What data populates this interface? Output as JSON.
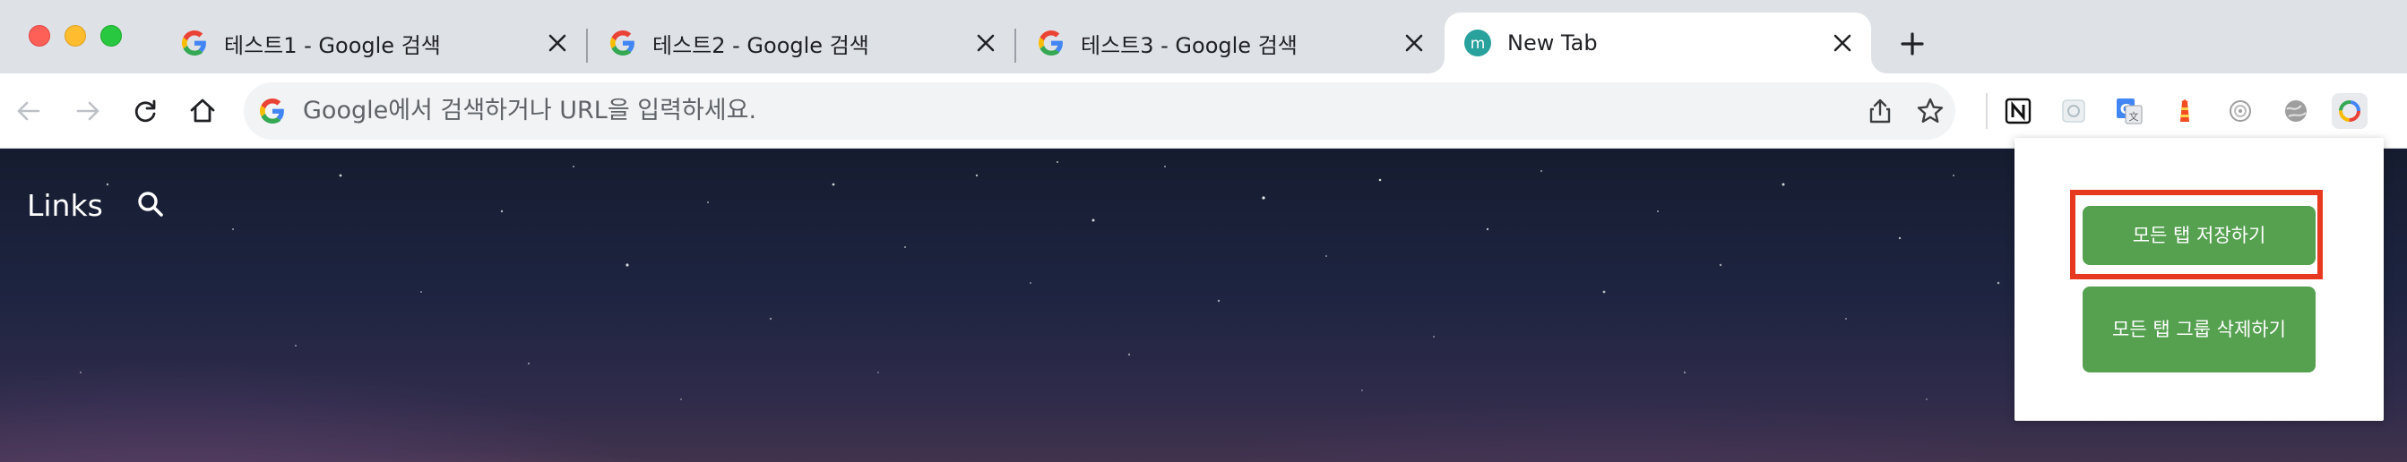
{
  "tabs": [
    {
      "title": "테스트1 - Google 검색",
      "favicon": "google-icon",
      "active": false
    },
    {
      "title": "테스트2 - Google 검색",
      "favicon": "google-icon",
      "active": false
    },
    {
      "title": "테스트3 - Google 검색",
      "favicon": "google-icon",
      "active": false
    },
    {
      "title": "New Tab",
      "favicon": "m-icon",
      "favicon_letter": "m",
      "active": true
    }
  ],
  "omnibox": {
    "placeholder": "Google에서 검색하거나 URL을 입력하세요."
  },
  "extensions": [
    "notion-icon",
    "grid-icon",
    "google-translate-icon",
    "lighthouse-icon",
    "spiral-icon",
    "globe-icon",
    "color-ring-icon"
  ],
  "page": {
    "links_label": "Links"
  },
  "popup": {
    "save_all_tabs": "모든 탭 저장하기",
    "delete_all_groups": "모든 탭 그룹 삭제하기"
  },
  "colors": {
    "popup_button": "#55a150",
    "highlight_border": "#e6391f",
    "tabstrip_bg": "#dee1e6",
    "new_tab_favicon": "#29a19c"
  }
}
